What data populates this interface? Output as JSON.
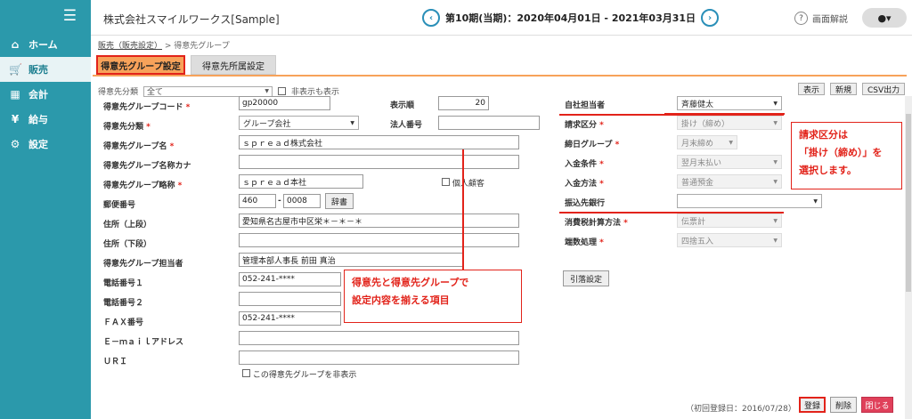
{
  "sidebar": {
    "items": [
      {
        "label": "ホーム",
        "icon": "home-icon",
        "glyph": "⌂"
      },
      {
        "label": "販売",
        "icon": "cart-icon",
        "glyph": "🛒"
      },
      {
        "label": "会計",
        "icon": "calculator-icon",
        "glyph": "▦"
      },
      {
        "label": "給与",
        "icon": "money-bag-icon",
        "glyph": "¥"
      },
      {
        "label": "設定",
        "icon": "gear-icon",
        "glyph": "⚙"
      }
    ],
    "active": 1
  },
  "header": {
    "company": "株式会社スマイルワークス[Sample]",
    "period": "第10期(当期)：2020年04月01日 - 2021年03月31日",
    "help": "画面解説"
  },
  "breadcrumb": {
    "link": "販売（販売設定）",
    "sep": " > ",
    "current": "得意先グループ"
  },
  "tabs": [
    "得意先グループ設定",
    "得意先所属設定"
  ],
  "filter": {
    "label": "得意先分類",
    "value": "全て",
    "hidden_label": "非表示も表示"
  },
  "toolbar": [
    "表示",
    "新規",
    "CSV出力"
  ],
  "labels": {
    "code": "得意先グループコード",
    "class": "得意先分類",
    "name": "得意先グループ名",
    "kana": "得意先グループ名称カナ",
    "abbr": "得意先グループ略称",
    "zip": "郵便番号",
    "addr1": "住所（上段）",
    "addr2": "住所（下段）",
    "person": "得意先グループ担当者",
    "tel1": "電話番号１",
    "tel2": "電話番号２",
    "fax": "ＦＡＸ番号",
    "email": "Ｅ－ｍａｉｌアドレス",
    "uri": "ＵＲＩ",
    "order": "表示順",
    "corp": "法人番号",
    "staff": "自社担当者",
    "billing": "請求区分",
    "closing": "締日グループ",
    "payterm": "入金条件",
    "paymethod": "入金方法",
    "bank": "振込先銀行",
    "taxcalc": "消費税計算方法",
    "rounding": "端数処理"
  },
  "values": {
    "code": "gp20000",
    "class": "グループ会社",
    "name": "ｓｐｒｅａｄ株式会社",
    "kana": "",
    "abbr": "ｓｐｒｅａｄ本社",
    "zip1": "460",
    "zip2": "0008",
    "addr1": "愛知県名古屋市中区栄＊－＊－＊",
    "addr2": "",
    "person": "管理本部人事長 前田 真治",
    "tel1": "052-241-****",
    "tel2": "",
    "fax": "052-241-****",
    "email": "",
    "uri": "",
    "order": "20",
    "corp": "",
    "staff": "斉藤健太",
    "billing": "掛け（締め）",
    "closing": "月末締め",
    "payterm": "翌月末払い",
    "paymethod": "普通預金",
    "bank": "",
    "taxcalc": "伝票計",
    "rounding": "四捨五入"
  },
  "buttons": {
    "dict": "辞書",
    "kojo": "引落設定",
    "register": "登録",
    "delete": "削除",
    "close": "閉じる"
  },
  "individual": "個人顧客",
  "hide_group": "この得意先グループを非表示",
  "first_reg": "（初回登録日：2016/07/28）",
  "callouts": {
    "right": [
      "請求区分は",
      "「掛け（締め）」を",
      "選択します。"
    ],
    "center": [
      "得意先と得意先グループで",
      "設定内容を揃える項目"
    ]
  },
  "colors": {
    "sidebar": "#2b99ab",
    "accent": "#e2231a",
    "tab": "#f7a25a"
  }
}
